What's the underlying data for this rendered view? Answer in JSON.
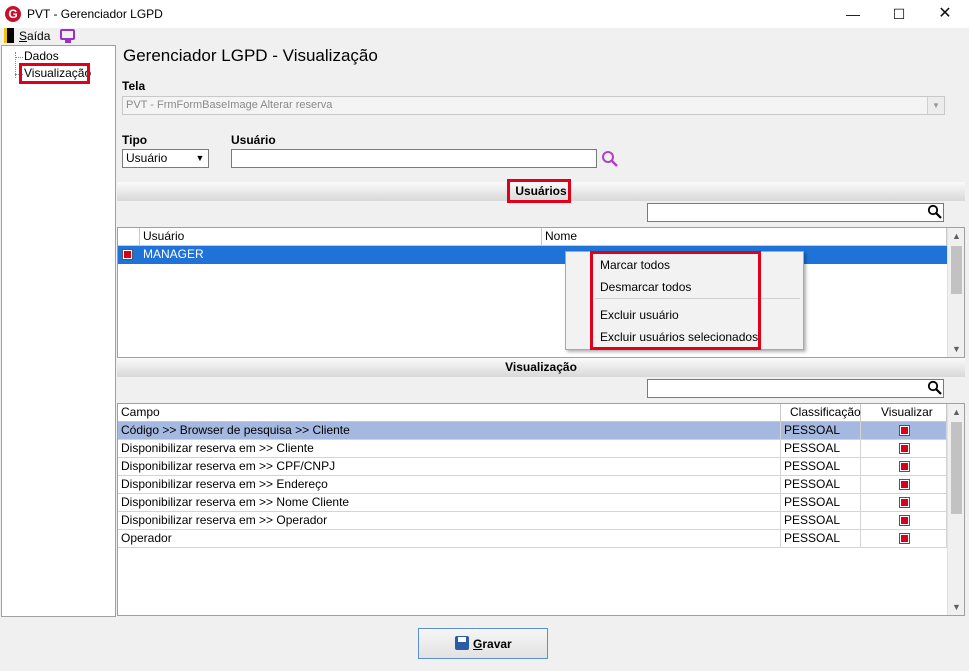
{
  "window": {
    "title": "PVT - Gerenciador LGPD",
    "logo_letter": "G",
    "minimize": "—",
    "maximize": "☐",
    "close": "✕"
  },
  "toolbar": {
    "exit_label": "Saída"
  },
  "tree": {
    "items": [
      "Dados",
      "Visualização"
    ]
  },
  "main": {
    "title": "Gerenciador LGPD - Visualização",
    "tela_label": "Tela",
    "tela_value": "PVT - FrmFormBaseImage Alterar reserva",
    "tipo_label": "Tipo",
    "tipo_value": "Usuário",
    "usuario_label": "Usuário",
    "usuario_value": ""
  },
  "usuarios_section": {
    "title": "Usuários",
    "columns": [
      "Usuário",
      "Nome"
    ],
    "rows": [
      {
        "usuario": "MANAGER",
        "nome": "",
        "checked": true
      }
    ]
  },
  "context_menu": {
    "items": [
      "Marcar todos",
      "Desmarcar todos",
      "Excluir usuário",
      "Excluir usuários selecionados"
    ]
  },
  "visualizacao_section": {
    "title": "Visualização",
    "columns": [
      "Campo",
      "Classificação",
      "Visualizar"
    ],
    "rows": [
      {
        "campo": "Código >> Browser de pesquisa >> Cliente",
        "classificacao": "PESSOAL",
        "visualizar": true
      },
      {
        "campo": "Disponibilizar reserva em >> Cliente",
        "classificacao": "PESSOAL",
        "visualizar": true
      },
      {
        "campo": "Disponibilizar reserva em >> CPF/CNPJ",
        "classificacao": "PESSOAL",
        "visualizar": true
      },
      {
        "campo": "Disponibilizar reserva em >> Endereço",
        "classificacao": "PESSOAL",
        "visualizar": true
      },
      {
        "campo": "Disponibilizar reserva em >> Nome Cliente",
        "classificacao": "PESSOAL",
        "visualizar": true
      },
      {
        "campo": "Disponibilizar reserva em >> Operador",
        "classificacao": "PESSOAL",
        "visualizar": true
      },
      {
        "campo": "Operador",
        "classificacao": "PESSOAL",
        "visualizar": true
      }
    ]
  },
  "footer": {
    "save_label": "Gravar"
  },
  "colors": {
    "highlight_red": "#e0001a",
    "selection_blue": "#1e72d8",
    "row_highlight": "#a4b8e0",
    "checkbox_red": "#d6001c",
    "logo_red": "#c8102e",
    "monitor_purple": "#9b30c8"
  },
  "icons": [
    "app-logo-icon",
    "exit-icon",
    "monitor-icon",
    "search-icon",
    "dropdown-arrow-icon",
    "save-disk-icon"
  ]
}
